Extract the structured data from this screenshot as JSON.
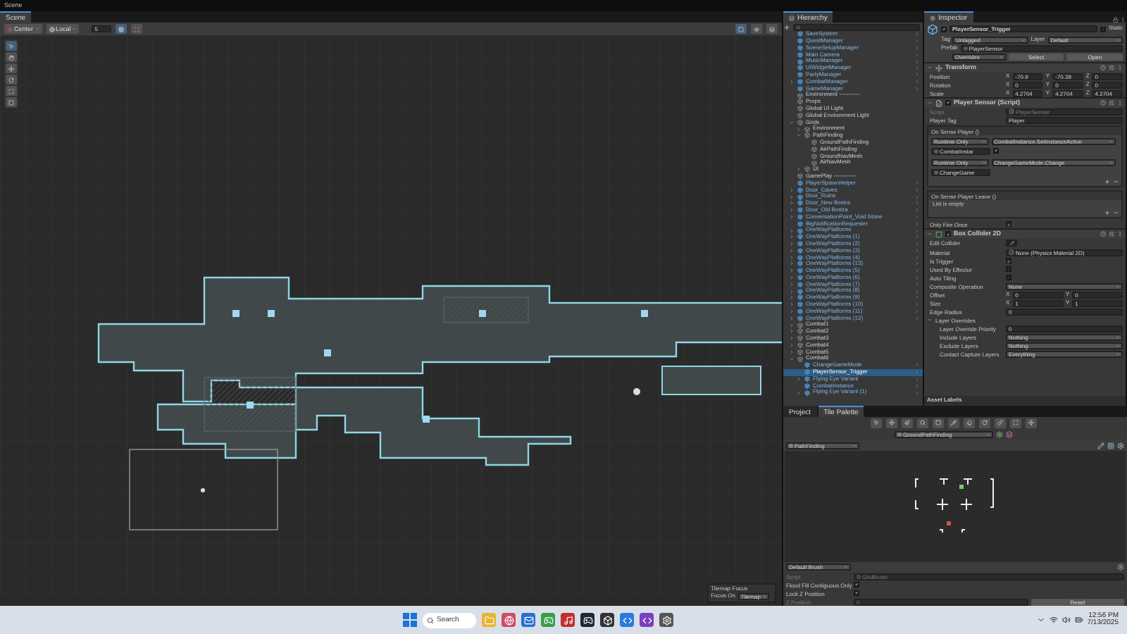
{
  "window": {
    "title": "Scene"
  },
  "scene": {
    "tab": "Scene",
    "pivot": "Center",
    "space": "Local",
    "grid_value": "5",
    "overlay": {
      "title": "Tilemap Focus",
      "label": "Focus On",
      "value": "Tilemap"
    }
  },
  "hierarchy": {
    "tab": "Hierarchy",
    "items": [
      {
        "name": "SaveSystem",
        "kind": "prefab",
        "selected": false
      },
      {
        "name": "QuestManager",
        "kind": "prefab",
        "selected": false
      },
      {
        "name": "SceneSetupManager",
        "kind": "prefab",
        "selected": false
      },
      {
        "name": "Main Camera",
        "kind": "prefab",
        "selected": false
      },
      {
        "name": "MusicManager",
        "kind": "prefab",
        "selected": false
      },
      {
        "name": "UIWidgetManager",
        "kind": "prefab",
        "selected": false
      },
      {
        "name": "PartyManager",
        "kind": "prefab",
        "selected": false
      },
      {
        "name": "CombatManager",
        "kind": "prefab",
        "selected": false,
        "expanded": false
      },
      {
        "name": "GameManager",
        "kind": "prefab",
        "selected": false
      },
      {
        "name": "Environment -----------",
        "kind": "object",
        "selected": false
      },
      {
        "name": "Props",
        "kind": "object",
        "selected": false
      },
      {
        "name": "Global UI Light",
        "kind": "object",
        "selected": false
      },
      {
        "name": "Global Environment Light",
        "kind": "object",
        "selected": false
      },
      {
        "name": "Grids",
        "kind": "object",
        "selected": false,
        "expanded": true,
        "children": [
          {
            "name": "Environment",
            "kind": "object",
            "selected": false,
            "expanded": false
          },
          {
            "name": "PathFinding",
            "kind": "object",
            "selected": false,
            "expanded": true,
            "children": [
              {
                "name": "GroundPathFinding",
                "kind": "object",
                "selected": false
              },
              {
                "name": "AirPathFinding",
                "kind": "object",
                "selected": false
              },
              {
                "name": "GroundNavMesh",
                "kind": "object",
                "selected": false
              },
              {
                "name": "AirNavMesh",
                "kind": "object",
                "selected": false
              }
            ]
          },
          {
            "name": "UI",
            "kind": "object",
            "selected": false,
            "expanded": false
          }
        ]
      },
      {
        "name": "GamePlay ------------",
        "kind": "object",
        "selected": false
      },
      {
        "name": "PlayerSpawnHelper",
        "kind": "prefab",
        "selected": false
      },
      {
        "name": "Door_Caves",
        "kind": "prefab",
        "selected": false,
        "expanded": false
      },
      {
        "name": "Door_Ruins",
        "kind": "prefab",
        "selected": false,
        "expanded": false
      },
      {
        "name": "Door_New Bostra",
        "kind": "prefab",
        "selected": false,
        "expanded": false
      },
      {
        "name": "Door_Old Bostra",
        "kind": "prefab",
        "selected": false,
        "expanded": false
      },
      {
        "name": "ConversationPoint_Void Stone",
        "kind": "prefab",
        "selected": false,
        "expanded": false
      },
      {
        "name": "BigNotificationRequester",
        "kind": "prefab",
        "selected": false
      },
      {
        "name": "OneWayPlatforms",
        "kind": "prefab",
        "selected": false,
        "expanded": false
      },
      {
        "name": "OneWayPlatforms (1)",
        "kind": "prefab",
        "selected": false,
        "expanded": false
      },
      {
        "name": "OneWayPlatforms (2)",
        "kind": "prefab",
        "selected": false,
        "expanded": false
      },
      {
        "name": "OneWayPlatforms (3)",
        "kind": "prefab",
        "selected": false,
        "expanded": false
      },
      {
        "name": "OneWayPlatforms (4)",
        "kind": "prefab",
        "selected": false,
        "expanded": false
      },
      {
        "name": "OneWayPlatforms (13)",
        "kind": "prefab",
        "selected": false,
        "expanded": false
      },
      {
        "name": "OneWayPlatforms (5)",
        "kind": "prefab",
        "selected": false,
        "expanded": false
      },
      {
        "name": "OneWayPlatforms (6)",
        "kind": "prefab",
        "selected": false,
        "expanded": false
      },
      {
        "name": "OneWayPlatforms (7)",
        "kind": "prefab",
        "selected": false,
        "expanded": false
      },
      {
        "name": "OneWayPlatforms (8)",
        "kind": "prefab",
        "selected": false,
        "expanded": false
      },
      {
        "name": "OneWayPlatforms (9)",
        "kind": "prefab",
        "selected": false,
        "expanded": false
      },
      {
        "name": "OneWayPlatforms (10)",
        "kind": "prefab",
        "selected": false,
        "expanded": false
      },
      {
        "name": "OneWayPlatforms (11)",
        "kind": "prefab",
        "selected": false,
        "expanded": false
      },
      {
        "name": "OneWayPlatforms (12)",
        "kind": "prefab",
        "selected": false,
        "expanded": false
      },
      {
        "name": "Combat1",
        "kind": "object",
        "selected": false,
        "expanded": false
      },
      {
        "name": "Combat2",
        "kind": "object",
        "selected": false,
        "expanded": false
      },
      {
        "name": "Combat3",
        "kind": "object",
        "selected": false,
        "expanded": false
      },
      {
        "name": "Combat4",
        "kind": "object",
        "selected": false,
        "expanded": false
      },
      {
        "name": "Combat5",
        "kind": "object",
        "selected": false,
        "expanded": false
      },
      {
        "name": "Combat6",
        "kind": "object",
        "selected": false,
        "expanded": true,
        "children": [
          {
            "name": "ChangeGameMode",
            "kind": "prefab",
            "selected": false
          },
          {
            "name": "PlayerSensor_Trigger",
            "kind": "prefab",
            "selected": true
          },
          {
            "name": "Flying Eye Variant",
            "kind": "prefab",
            "selected": false,
            "expanded": false
          },
          {
            "name": "CombatInstance",
            "kind": "prefab",
            "selected": false
          },
          {
            "name": "Flying Eye Variant (1)",
            "kind": "prefab",
            "selected": false,
            "expanded": false
          }
        ]
      }
    ]
  },
  "inspector": {
    "tab": "Inspector",
    "object_name": "PlayerSensor_Trigger",
    "active": true,
    "static_label": "Static",
    "static": false,
    "tag_label": "Tag",
    "tag": "Untagged",
    "layer_label": "Layer",
    "layer": "Default",
    "prefab_label": "Prefab",
    "prefab": "PlayerSensor",
    "overrides": "Overrides",
    "select": "Select",
    "open": "Open",
    "components": [
      {
        "kind": "transform",
        "title": "Transform",
        "expanded": true,
        "rows": [
          {
            "kind": "vector",
            "label": "Position",
            "axes": [
              {
                "axis": "X",
                "value": "-70.9"
              },
              {
                "axis": "Y",
                "value": "-70.39"
              },
              {
                "axis": "Z",
                "value": "0"
              }
            ]
          },
          {
            "kind": "vector",
            "label": "Rotation",
            "axes": [
              {
                "axis": "X",
                "value": "0"
              },
              {
                "axis": "Y",
                "value": "0"
              },
              {
                "axis": "Z",
                "value": "0"
              }
            ]
          },
          {
            "kind": "vector",
            "label": "Scale",
            "axes": [
              {
                "axis": "X",
                "value": "4.2704"
              },
              {
                "axis": "Y",
                "value": "4.2704"
              },
              {
                "axis": "Z",
                "value": "4.2704"
              }
            ]
          }
        ]
      },
      {
        "kind": "script",
        "title": "Player Sensor (Script)",
        "expanded": true,
        "enabled": true,
        "rows": [
          {
            "kind": "object",
            "label": "Script",
            "value": "PlayerSensor",
            "disabled": true
          },
          {
            "kind": "text",
            "label": "Player Tag",
            "value": "Player"
          },
          {
            "kind": "event",
            "label": "On Sense Player ()",
            "listeners": [
              {
                "kind": "bool",
                "mode": "Runtime Only",
                "function": "CombatInstance.SetInstanceActive",
                "target": "CombatInstar",
                "checked": true
              },
              {
                "kind": "void",
                "mode": "Runtime Only",
                "function": "ChangeGameMode.Change",
                "target": "ChangeGame"
              }
            ]
          },
          {
            "kind": "event",
            "label": "On Sense Player Leave ()",
            "empty_text": "List is empty"
          },
          {
            "kind": "check",
            "label": "Only Fire Once",
            "checked": true
          }
        ]
      },
      {
        "kind": "collider",
        "title": "Box Collider 2D",
        "expanded": true,
        "enabled": true,
        "rows": [
          {
            "kind": "edit",
            "label": "Edit Collider"
          },
          {
            "kind": "object",
            "label": "Material",
            "value": "None (Physics Material 2D)",
            "disabled": false
          },
          {
            "kind": "check",
            "label": "Is Trigger",
            "checked": true
          },
          {
            "kind": "check",
            "label": "Used By Effector",
            "checked": false
          },
          {
            "kind": "check",
            "label": "Auto Tiling",
            "checked": false
          },
          {
            "kind": "dropdown",
            "label": "Composite Operation",
            "value": "None"
          },
          {
            "kind": "vector",
            "label": "Offset",
            "axes": [
              {
                "axis": "X",
                "value": "0"
              },
              {
                "axis": "Y",
                "value": "0"
              }
            ]
          },
          {
            "kind": "vector",
            "label": "Size",
            "axes": [
              {
                "axis": "X",
                "value": "1"
              },
              {
                "axis": "Y",
                "value": "1"
              }
            ]
          },
          {
            "kind": "text",
            "label": "Edge Radius",
            "value": "0"
          },
          {
            "kind": "foldout",
            "label": "Layer Overrides",
            "expanded": true,
            "rows": [
              {
                "kind": "text",
                "label": "Layer Override Priority",
                "value": "0"
              },
              {
                "kind": "dropdown",
                "label": "Include Layers",
                "value": "Nothing"
              },
              {
                "kind": "dropdown",
                "label": "Exclude Layers",
                "value": "Nothing"
              },
              {
                "kind": "dropdown",
                "label": "Contact Capture Layers",
                "value": "Everything"
              }
            ]
          }
        ]
      }
    ],
    "asset_labels": "Asset Labels"
  },
  "bottom_panel": {
    "tabs": [
      {
        "label": "Project",
        "selected": false
      },
      {
        "label": "Tile Palette",
        "selected": true
      }
    ],
    "active_tilemap": "GroundPathFinding",
    "palette": "PathFinding",
    "brush": "Default Brush",
    "script_label": "Script",
    "script": "GridBrush",
    "options": [
      {
        "kind": "check",
        "label": "Flood Fill Contiguous Only",
        "checked": true
      },
      {
        "kind": "check",
        "label": "Lock Z Position",
        "checked": true
      },
      {
        "kind": "number",
        "label": "Z Position",
        "value": "0",
        "disabled": true
      }
    ],
    "reset": "Reset"
  },
  "taskbar": {
    "search": "Search",
    "time": "12:56 PM",
    "date": "7/13/2025"
  }
}
